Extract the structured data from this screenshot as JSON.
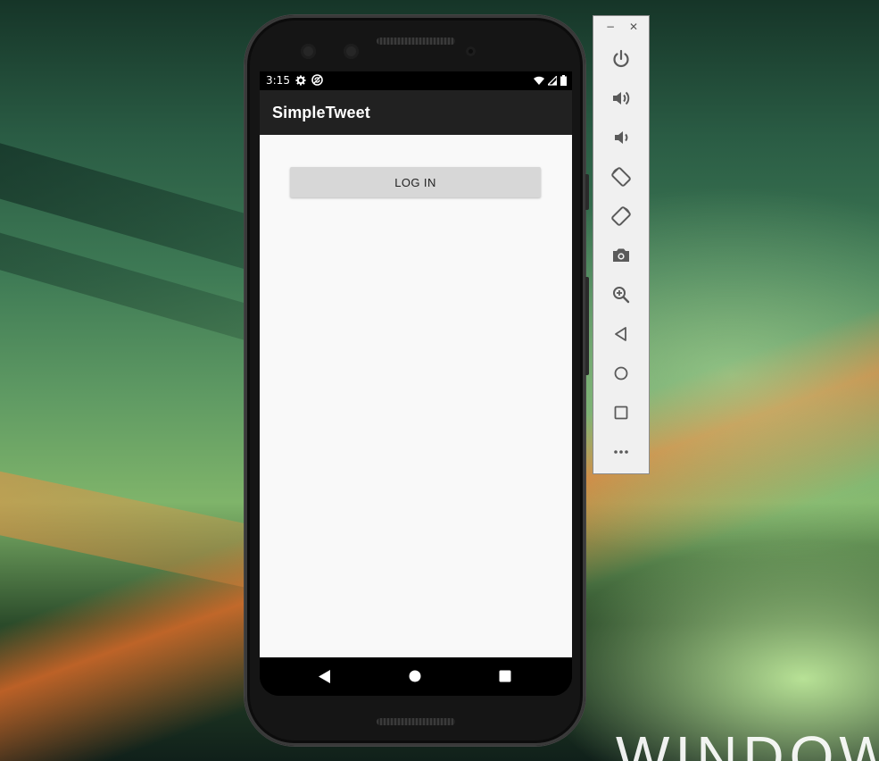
{
  "status_bar": {
    "time": "3:15",
    "left_icons": [
      "gear-icon",
      "sync-icon"
    ],
    "right_icons": [
      "wifi-icon",
      "signal-icon",
      "battery-icon"
    ]
  },
  "app": {
    "title": "SimpleTweet",
    "login_button_label": "LOG IN"
  },
  "nav_bar": {
    "buttons": [
      "back",
      "home",
      "recents"
    ]
  },
  "emulator_controls": {
    "window_buttons": {
      "minimize": "−",
      "close": "✕"
    },
    "buttons": [
      "power",
      "volume-up",
      "volume-down",
      "rotate-left",
      "rotate-right",
      "screenshot",
      "zoom",
      "back",
      "home",
      "overview",
      "more"
    ]
  },
  "desktop": {
    "wallpaper_text": "WINDOW"
  },
  "colors": {
    "appbar": "#212121",
    "content_bg": "#f9f9f9",
    "button_bg": "#d7d7d7",
    "emulator_panel": "#f0f0f0"
  }
}
